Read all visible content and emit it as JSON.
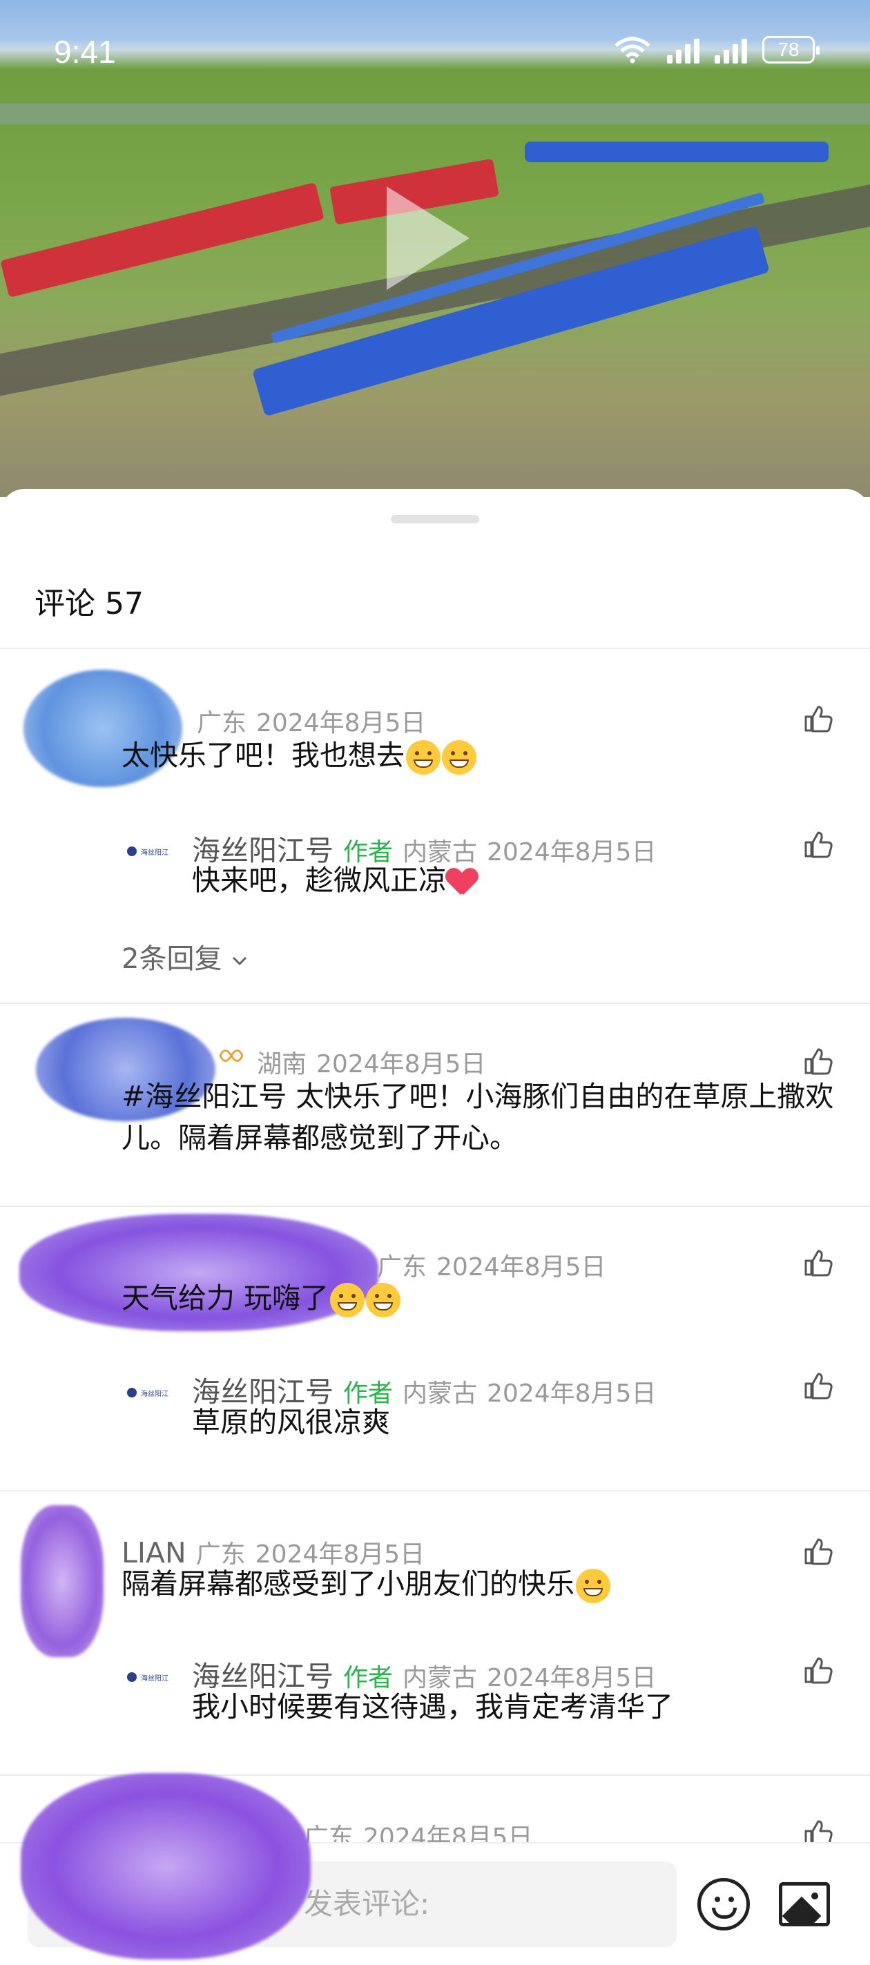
{
  "status_bar": {
    "time": "9:41",
    "battery": "78"
  },
  "sheet": {
    "title": "评论 57"
  },
  "comments": [
    {
      "name": "",
      "region": "广东",
      "date": "2024年8月5日",
      "text": "太快乐了吧！我也想去",
      "reply": {
        "name": "海丝阳江号",
        "author_tag": "作者",
        "region": "内蒙古",
        "date": "2024年8月5日",
        "text": "快来吧，趁微风正凉"
      },
      "replies_link": "2条回复"
    },
    {
      "name": "",
      "region": "湖南",
      "date": "2024年8月5日",
      "text": "#海丝阳江号 太快乐了吧！小海豚们自由的在草原上撒欢儿。隔着屏幕都感觉到了开心。"
    },
    {
      "name": "",
      "region": "广东",
      "date": "2024年8月5日",
      "text": "天气给力 玩嗨了",
      "reply": {
        "name": "海丝阳江号",
        "author_tag": "作者",
        "region": "内蒙古",
        "date": "2024年8月5日",
        "text": "草原的风很凉爽"
      }
    },
    {
      "name": "LIAN",
      "region": "广东",
      "date": "2024年8月5日",
      "text": "隔着屏幕都感受到了小朋友们的快乐",
      "reply": {
        "name": "海丝阳江号",
        "author_tag": "作者",
        "region": "内蒙古",
        "date": "2024年8月5日",
        "text": "我小时候要有这待遇，我肯定考清华了"
      }
    },
    {
      "name": "",
      "region": "广东",
      "date": "2024年8月5日",
      "text": ""
    }
  ],
  "input_bar": {
    "placeholder": "发表评论:"
  },
  "colors": {
    "author_green": "#2bb24c",
    "meta_gray": "#9a9a9a",
    "heart_red": "#f0405f"
  },
  "icons": [
    "wifi-icon",
    "signal-icon",
    "battery-icon",
    "play-icon",
    "like-icon",
    "chevron-down-icon",
    "emoji-icon",
    "image-icon"
  ]
}
